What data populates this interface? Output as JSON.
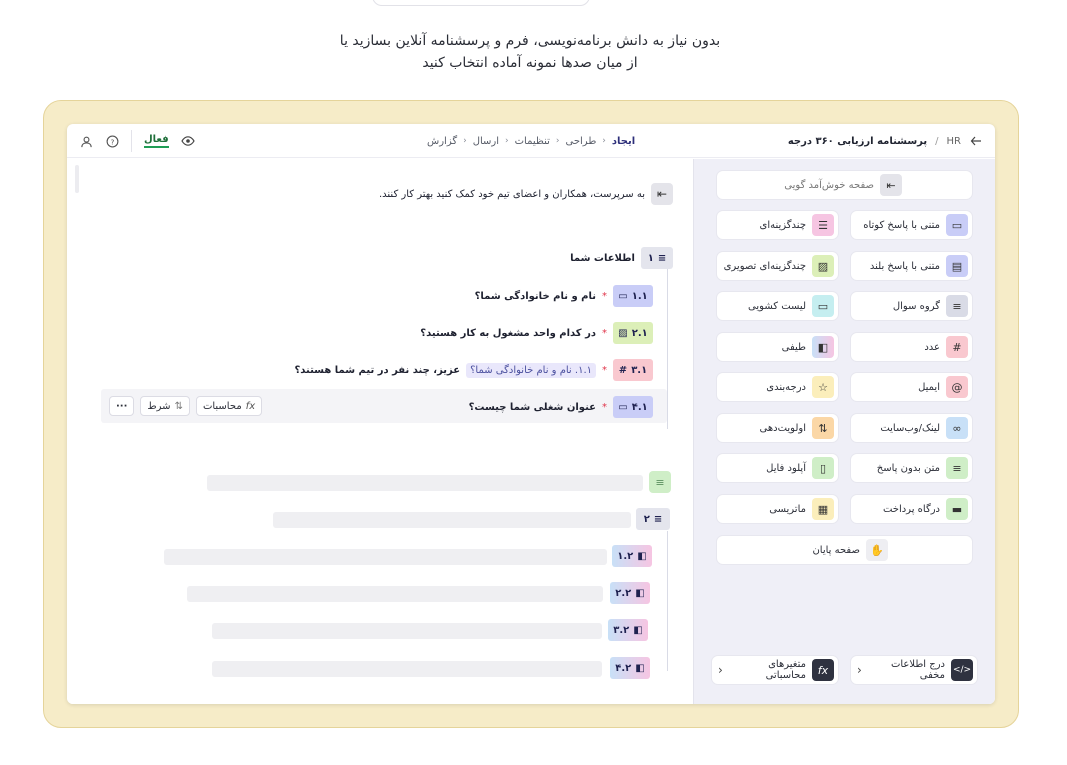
{
  "headline": {
    "line1": "بدون نیاز به دانش برنامه‌نویسی، فرم و پرسشنامه آنلاین بسازید یا",
    "line2": "از میان صدها نمونه آماده انتخاب کنید"
  },
  "topbar": {
    "breadcrumb_workspace": "HR",
    "breadcrumb_sep": "/",
    "form_title": "پرسشنامه ارزیابی ۳۶۰ درجه",
    "steps": [
      {
        "label": "ایجاد",
        "active": true
      },
      {
        "label": "طراحی",
        "active": false
      },
      {
        "label": "تنظیمات",
        "active": false
      },
      {
        "label": "ارسال",
        "active": false
      },
      {
        "label": "گزارش",
        "active": false
      }
    ],
    "status": "فعال"
  },
  "canvas": {
    "welcome_text": "به سرپرست، همکاران و اعضای تیم خود کمک کنید بهتر کار کنند.",
    "group1": {
      "number": "۱",
      "title": "اطلاعات شما"
    },
    "questions": [
      {
        "number": "۱.۱",
        "text": "نام و نام خانوادگی شما؟",
        "color": "#c9cdf7"
      },
      {
        "number": "۲.۱",
        "text": "در کدام واحد مشغول به کار هستید؟",
        "color": "#dcefb8"
      },
      {
        "number": "۳.۱",
        "pipe": "۱.۱. نام و نام خانوادگی شما؟",
        "text": "عزیز، چند نفر در تیم شما هستند؟",
        "color": "#f9c8cf"
      },
      {
        "number": "۴.۱",
        "text": "عنوان شغلی شما چیست؟",
        "color": "#c9cdf7"
      }
    ],
    "actions": {
      "calc": "محاسبات",
      "condition": "شرط",
      "more": "···"
    },
    "group2": {
      "number": "۲"
    },
    "group2_items": [
      "۱.۲",
      "۲.۲",
      "۳.۲",
      "۴.۲"
    ]
  },
  "panel": {
    "welcome": "صفحه خوش‌آمد گویی",
    "items": [
      {
        "label": "متنی با پاسخ کوتاه",
        "icon": "short-text-icon",
        "color": "#c9cdf7",
        "glyph": "▭"
      },
      {
        "label": "چندگزینه‌ای",
        "icon": "multiple-choice-icon",
        "color": "#f6c5e2",
        "glyph": "☰"
      },
      {
        "label": "متنی با پاسخ بلند",
        "icon": "long-text-icon",
        "color": "#c9cdf7",
        "glyph": "▤"
      },
      {
        "label": "چندگزینه‌ای تصویری",
        "icon": "picture-choice-icon",
        "color": "#dcefb8",
        "glyph": "▨"
      },
      {
        "label": "گروه سوال",
        "icon": "question-group-icon",
        "color": "#d9dbe6",
        "glyph": "≡"
      },
      {
        "label": "لیست کشویی",
        "icon": "dropdown-icon",
        "color": "#c5eef0",
        "glyph": "▭"
      },
      {
        "label": "عدد",
        "icon": "number-icon",
        "color": "#f9c8cf",
        "glyph": "#"
      },
      {
        "label": "طیفی",
        "icon": "range-icon",
        "color": "#c8e0f7",
        "glyph": "◧"
      },
      {
        "label": "ایمیل",
        "icon": "email-icon",
        "color": "#f9c8cf",
        "glyph": "@"
      },
      {
        "label": "درجه‌بندی",
        "icon": "rating-icon",
        "color": "#fbeebb",
        "glyph": "☆"
      },
      {
        "label": "لینک/وب‌سایت",
        "icon": "link-icon",
        "color": "#c8e0f7",
        "glyph": "∞"
      },
      {
        "label": "اولویت‌دهی",
        "icon": "ranking-icon",
        "color": "#fbd7a6",
        "glyph": "⇅"
      },
      {
        "label": "متن بدون پاسخ",
        "icon": "statement-icon",
        "color": "#cfeec7",
        "glyph": "≡"
      },
      {
        "label": "آپلود فایل",
        "icon": "file-upload-icon",
        "color": "#cfeec7",
        "glyph": "▯"
      },
      {
        "label": "درگاه پرداخت",
        "icon": "payment-icon",
        "color": "#cfeec7",
        "glyph": "▬"
      },
      {
        "label": "ماتریسی",
        "icon": "matrix-icon",
        "color": "#fbeebb",
        "glyph": "▦"
      }
    ],
    "end_page": "صفحه پایان",
    "hidden_fields": "درج اطلاعات مخفی",
    "calc_vars": "متغیرهای محاسباتی"
  }
}
